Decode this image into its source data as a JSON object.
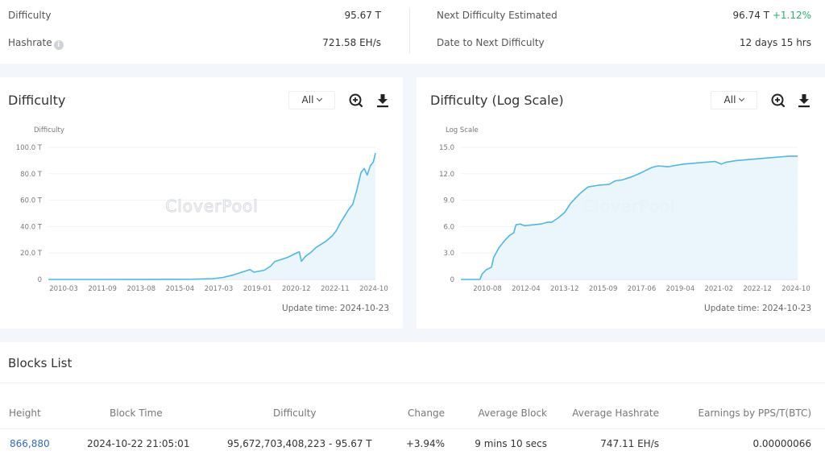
{
  "stats": {
    "difficulty_label": "Difficulty",
    "difficulty_value": "95.67 T",
    "hashrate_label": "Hashrate",
    "hashrate_value": "721.58 EH/s",
    "next_label": "Next Difficulty Estimated",
    "next_value": "96.74 T",
    "next_change": "+1.12%",
    "date_label": "Date to Next Difficulty",
    "date_value": "12 days 15 hrs",
    "info_icon": "i"
  },
  "colors": {
    "line": "#4db7e6",
    "area": "#e8f5fb",
    "positive": "#23b26d",
    "link": "#2f6bb5"
  },
  "watermark": "CloverPool",
  "charts": {
    "left": {
      "title": "Difficulty",
      "range": "All",
      "update_time": "Update time: 2024-10-23"
    },
    "right": {
      "title": "Difficulty (Log Scale)",
      "range": "All",
      "update_time": "Update time: 2024-10-23"
    }
  },
  "chart_data": [
    {
      "type": "area",
      "title": "Difficulty",
      "ylabel": "Difficulty",
      "xlabel": "",
      "ylim": [
        0,
        100
      ],
      "y_unit": "T",
      "yticks": [
        "0",
        "20.0 T",
        "40.0 T",
        "60.0 T",
        "80.0 T",
        "100.0 T"
      ],
      "ytick_values": [
        0,
        20,
        40,
        60,
        80,
        100
      ],
      "xticks": [
        "2010-03",
        "2011-09",
        "2013-08",
        "2015-04",
        "2017-03",
        "2019-01",
        "2020-12",
        "2022-11",
        "2024-10"
      ],
      "xlim": [
        2009.0,
        2024.9
      ],
      "grid": true,
      "legend": "none",
      "x": [
        2009.0,
        2012.0,
        2014.0,
        2016.0,
        2017.0,
        2017.5,
        2018.0,
        2018.5,
        2018.8,
        2019.0,
        2019.5,
        2019.8,
        2020.0,
        2020.3,
        2020.6,
        2020.8,
        2021.0,
        2021.2,
        2021.3,
        2021.5,
        2021.8,
        2022.0,
        2022.3,
        2022.5,
        2022.8,
        2023.0,
        2023.2,
        2023.4,
        2023.6,
        2023.8,
        2024.0,
        2024.2,
        2024.35,
        2024.5,
        2024.65,
        2024.8,
        2024.9
      ],
      "values": [
        0,
        0.003,
        0.04,
        0.2,
        0.6,
        1.5,
        3.5,
        6,
        7.5,
        5.5,
        7,
        10,
        13.5,
        15,
        16.5,
        18,
        19.5,
        21,
        13.7,
        17.5,
        21,
        24,
        27,
        29,
        33,
        37,
        43,
        48,
        53,
        57,
        68,
        81,
        84,
        79,
        86,
        89,
        95.67
      ]
    },
    {
      "type": "area",
      "title": "Difficulty (Log Scale)",
      "ylabel": "Log Scale",
      "xlabel": "",
      "ylim": [
        0,
        15
      ],
      "yticks": [
        "0",
        "3.0",
        "6.0",
        "9.0",
        "12.0",
        "15.0"
      ],
      "ytick_values": [
        0,
        3,
        6,
        9,
        12,
        15
      ],
      "xticks": [
        "2010-08",
        "2012-04",
        "2013-12",
        "2015-09",
        "2017-06",
        "2019-04",
        "2021-02",
        "2022-12",
        "2024-10"
      ],
      "xlim": [
        2009.0,
        2024.9
      ],
      "grid": true,
      "legend": "none",
      "x": [
        2009.0,
        2009.9,
        2010.0,
        2010.2,
        2010.45,
        2010.55,
        2010.8,
        2011.1,
        2011.3,
        2011.5,
        2011.6,
        2011.8,
        2012.0,
        2012.4,
        2012.8,
        2013.1,
        2013.3,
        2013.6,
        2013.9,
        2014.2,
        2014.6,
        2015.0,
        2015.5,
        2016.0,
        2016.3,
        2016.6,
        2017.0,
        2017.5,
        2018.0,
        2018.3,
        2018.8,
        2019.0,
        2019.5,
        2020.0,
        2020.5,
        2021.0,
        2021.3,
        2021.5,
        2022.0,
        2022.5,
        2023.0,
        2023.5,
        2024.0,
        2024.5,
        2024.9
      ],
      "values": [
        0,
        0,
        0.6,
        1.1,
        1.4,
        2.5,
        3.6,
        4.5,
        5.0,
        5.3,
        6.2,
        6.3,
        6.1,
        6.2,
        6.3,
        6.5,
        6.5,
        7.0,
        7.6,
        8.7,
        9.7,
        10.5,
        10.7,
        10.8,
        11.2,
        11.3,
        11.6,
        12.1,
        12.7,
        12.9,
        12.8,
        12.9,
        13.1,
        13.2,
        13.3,
        13.4,
        13.1,
        13.3,
        13.5,
        13.6,
        13.7,
        13.8,
        13.9,
        14.0,
        14.0
      ]
    }
  ],
  "blocks": {
    "title": "Blocks List",
    "columns": [
      "Height",
      "Block Time",
      "Difficulty",
      "Change",
      "Average Block",
      "Average Hashrate",
      "Earnings by PPS/T(BTC)"
    ],
    "rows": [
      {
        "height": "866,880",
        "block_time": "2024-10-22 21:05:01",
        "difficulty": "95,672,703,408,223 - 95.67 T",
        "change": "+3.94%",
        "average_block": "9 mins 10 secs",
        "average_hashrate": "747.11 EH/s",
        "earnings": "0.00000066"
      }
    ]
  }
}
